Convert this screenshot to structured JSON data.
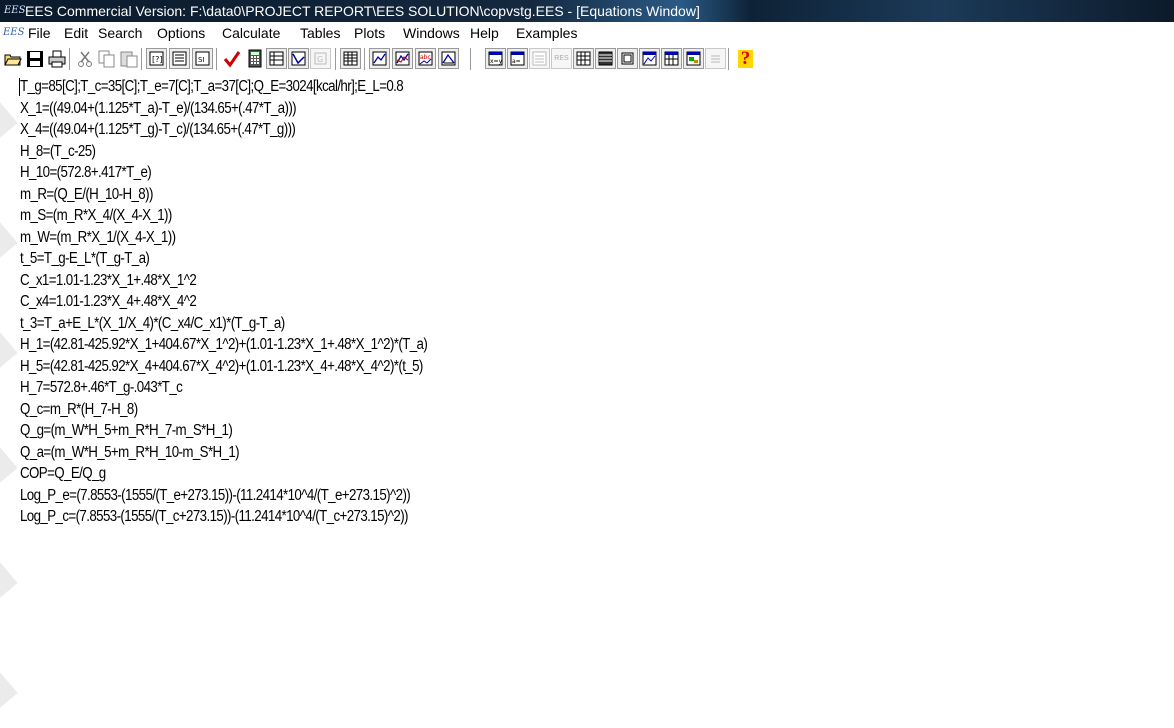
{
  "window": {
    "title": "EES Commercial Version:  F:\\data0\\PROJECT REPORT\\EES SOLUTION\\copvstg.EES - [Equations Window]",
    "app_icon_text": "EES"
  },
  "menubar": {
    "items": [
      {
        "label": "File"
      },
      {
        "label": "Edit"
      },
      {
        "label": "Search"
      },
      {
        "label": "Options"
      },
      {
        "label": "Calculate"
      },
      {
        "label": "Tables"
      },
      {
        "label": "Plots"
      },
      {
        "label": "Windows"
      },
      {
        "label": "Help"
      },
      {
        "label": "Examples"
      }
    ]
  },
  "toolbar": {
    "buttons": [
      {
        "icon": "open-folder-icon"
      },
      {
        "icon": "save-icon"
      },
      {
        "icon": "print-icon"
      },
      {
        "icon": "cut-icon"
      },
      {
        "icon": "copy-icon"
      },
      {
        "icon": "paste-icon"
      },
      {
        "icon": "unit-system-icon"
      },
      {
        "icon": "info-icon"
      },
      {
        "icon": "si-units-icon"
      },
      {
        "icon": "check-icon"
      },
      {
        "icon": "calculator-icon"
      },
      {
        "icon": "solve-table-icon"
      },
      {
        "icon": "min-max-icon"
      },
      {
        "icon": "disabled-icon"
      },
      {
        "icon": "parametric-table-icon"
      },
      {
        "icon": "new-plot-icon"
      },
      {
        "icon": "overlay-plot-icon"
      },
      {
        "icon": "abc-plot-icon"
      },
      {
        "icon": "modify-plot-icon"
      },
      {
        "icon": "equations-window-icon"
      },
      {
        "icon": "formatted-equations-icon"
      },
      {
        "icon": "solution-window-icon"
      },
      {
        "icon": "residuals-window-icon"
      },
      {
        "icon": "parametric-window-icon"
      },
      {
        "icon": "lookup-window-icon"
      },
      {
        "icon": "array-window-icon"
      },
      {
        "icon": "plot-window-icon"
      },
      {
        "icon": "integral-window-icon"
      },
      {
        "icon": "diagram-window-icon"
      },
      {
        "icon": "report-window-icon"
      },
      {
        "icon": "help-icon"
      }
    ],
    "residuals_label": "RES",
    "help_label": "?"
  },
  "equations": [
    "T_g=85[C];T_c=35[C];T_e=7[C];T_a=37[C];Q_E=3024[kcal/hr];E_L=0.8",
    "X_1=((49.04+(1.125*T_a)-T_e)/(134.65+(.47*T_a)))",
    "X_4=((49.04+(1.125*T_g)-T_c)/(134.65+(.47*T_g)))",
    "H_8=(T_c-25)",
    "H_10=(572.8+.417*T_e)",
    "m_R=(Q_E/(H_10-H_8))",
    "m_S=(m_R*X_4/(X_4-X_1))",
    "m_W=(m_R*X_1/(X_4-X_1))",
    "t_5=T_g-E_L*(T_g-T_a)",
    "C_x1=1.01-1.23*X_1+.48*X_1^2",
    "C_x4=1.01-1.23*X_4+.48*X_4^2",
    "t_3=T_a+E_L*(X_1/X_4)*(C_x4/C_x1)*(T_g-T_a)",
    "H_1=(42.81-425.92*X_1+404.67*X_1^2)+(1.01-1.23*X_1+.48*X_1^2)*(T_a)",
    "H_5=(42.81-425.92*X_4+404.67*X_4^2)+(1.01-1.23*X_4+.48*X_4^2)*(t_5)",
    "H_7=572.8+.46*T_g-.043*T_c",
    "Q_c=m_R*(H_7-H_8)",
    "Q_g=(m_W*H_5+m_R*H_7-m_S*H_1)",
    "Q_a=(m_W*H_5+m_R*H_10-m_S*H_1)",
    "COP=Q_E/Q_g",
    "Log_P_e=(7.8553-(1555/(T_e+273.15))-(11.2414*10^4/(T_e+273.15)^2))",
    "Log_P_c=(7.8553-(1555/(T_c+273.15))-(11.2414*10^4/(T_c+273.15)^2))"
  ]
}
